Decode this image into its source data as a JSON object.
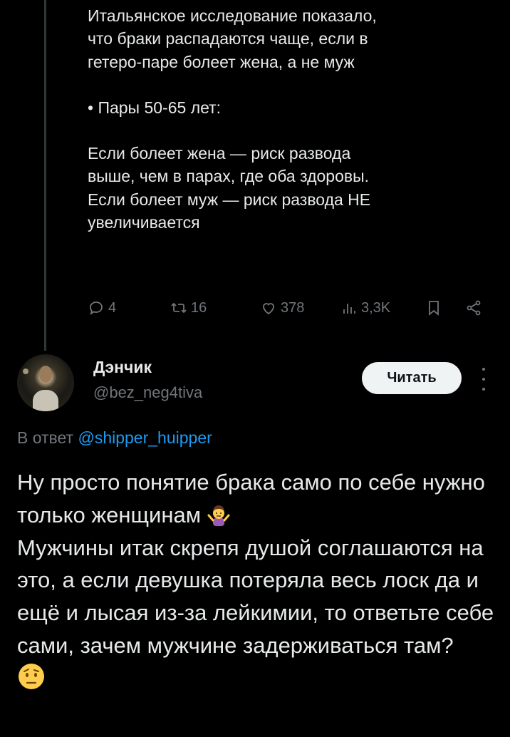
{
  "parent": {
    "paragraphs": [
      "Итальянское исследование показало,\nчто браки распадаются чаще, если в\nгетеро-паре болеет жена, а не муж",
      "• Пары 50-65 лет:",
      "Если болеет жена — риск развода\nвыше, чем в парах, где оба здоровы.\nЕсли болеет муж — риск развода НЕ\nувеличивается"
    ],
    "actions": {
      "replies": "4",
      "reposts": "16",
      "likes": "378",
      "views": "3,3K"
    }
  },
  "reply": {
    "author_name": "Дэнчик",
    "author_handle": "@bez_neg4tiva",
    "follow_label": "Читать",
    "reply_prefix": "В ответ",
    "reply_to": "@shipper_huipper",
    "text_line1": "Ну просто понятие брака само по себе нужно только женщинам",
    "text_line2": "Мужчины итак скрепя душой соглашаются на это, а если девушка потеряла весь лоск да и ещё и лысая из-за лейкимии, то ответьте себе сами, зачем мужчине задерживаться там?",
    "emoji1": "person-shrugging",
    "emoji2": "face-with-raised-eyebrow"
  },
  "colors": {
    "background": "#000000",
    "text": "#e7e9ea",
    "muted": "#71767b",
    "link": "#1d9bf0",
    "button_bg": "#eff3f4"
  }
}
